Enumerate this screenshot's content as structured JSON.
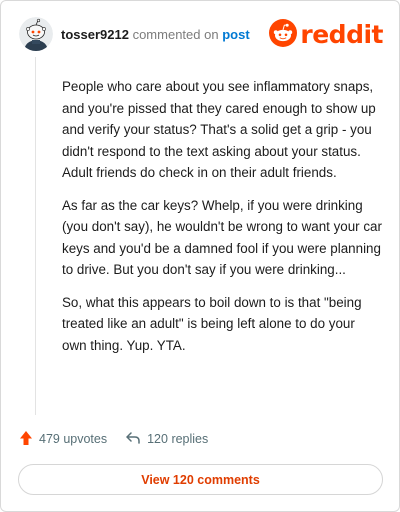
{
  "header": {
    "username": "tosser9212",
    "action": "commented on",
    "target_link": "post",
    "logo_text": "reddit",
    "logo_icon": "reddit-snoo-icon",
    "avatar_icon": "snoo-avatar-icon"
  },
  "comment": {
    "paragraphs": [
      "People who care about you see inflammatory snaps, and you're pissed that they cared enough to show up and verify your status? That's a solid get a grip - you didn't respond to the text asking about your status. Adult friends do check in on their adult friends.",
      "As far as the car keys? Whelp, if you were drinking (you don't say), he wouldn't be wrong to want your car keys and you'd be a damned fool if you were planning to drive. But you don't say if you were drinking...",
      "So, what this appears to boil down to is that \"being treated like an adult\" is being left alone to do your own thing. Yup. YTA."
    ]
  },
  "footer": {
    "upvotes": "479 upvotes",
    "upvote_icon": "upvote-arrow-icon",
    "replies": "120 replies",
    "reply_icon": "reply-arrow-icon",
    "view_comments": "View 120 comments"
  },
  "colors": {
    "brand": "#ff4500",
    "link": "#0079d3",
    "muted": "#576f76"
  }
}
